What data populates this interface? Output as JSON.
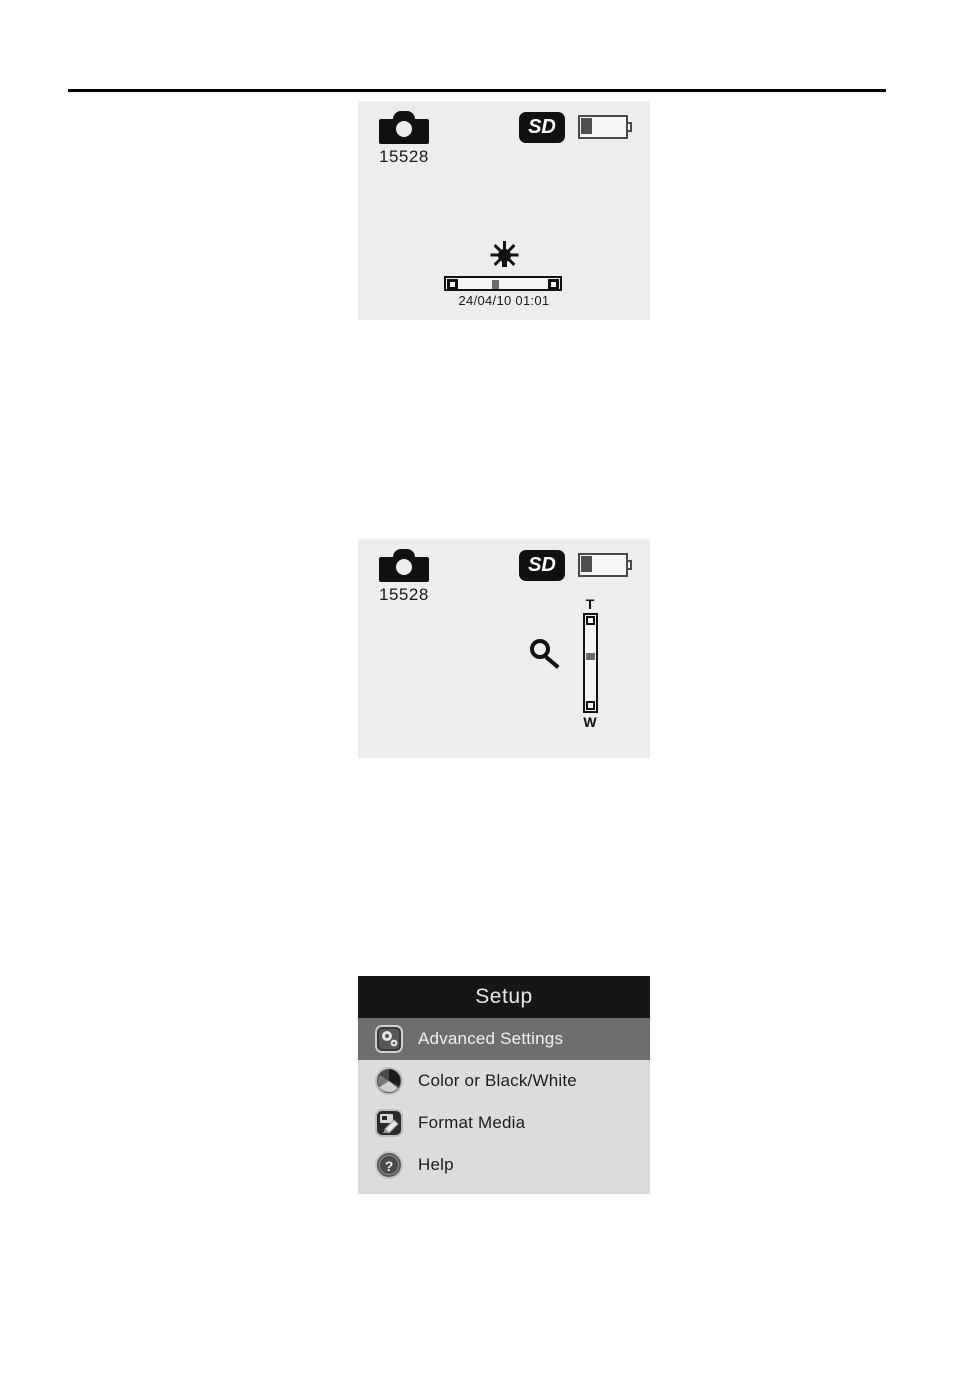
{
  "page": {
    "divider": "horizontal-rule"
  },
  "screens": {
    "capture": {
      "name": "capture-status-screen",
      "camera_icon": "camera-icon",
      "counter": "15528",
      "sd_badge": "SD",
      "battery_icon": "battery-icon",
      "brightness_icon": "sun-icon",
      "slider": "brightness-slider",
      "timestamp": "24/04/10  01:01"
    },
    "zoom": {
      "name": "zoom-status-screen",
      "camera_icon": "camera-icon",
      "counter": "15528",
      "sd_badge": "SD",
      "battery_icon": "battery-icon",
      "magnifier_icon": "magnifier-icon",
      "tele_label": "T",
      "wide_label": "W"
    },
    "setup": {
      "name": "setup-menu-screen",
      "title": "Setup",
      "items": [
        {
          "label": "Advanced Settings",
          "icon": "gears-icon",
          "selected": true
        },
        {
          "label": "Color or Black/White",
          "icon": "aperture-icon",
          "selected": false
        },
        {
          "label": "Format Media",
          "icon": "format-media-icon",
          "selected": false
        },
        {
          "label": "Help",
          "icon": "question-mark-icon",
          "selected": false
        }
      ]
    }
  },
  "colors": {
    "screen_background": "#ededed",
    "menu_background": "#dcdcdc",
    "menu_header": "#161616",
    "menu_highlight": "#6e6e6e",
    "foreground": "#111111"
  }
}
